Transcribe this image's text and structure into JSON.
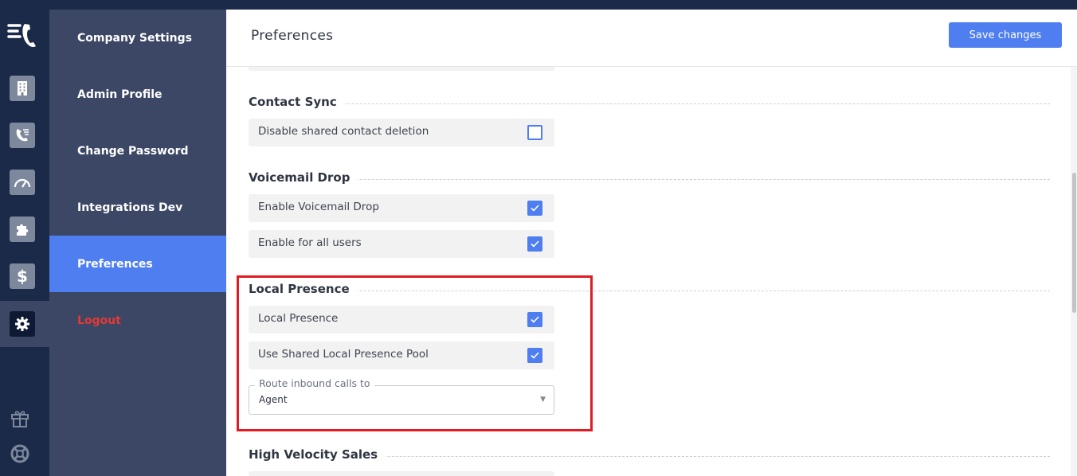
{
  "rail": {
    "icons": [
      "logo-icon",
      "building-icon",
      "phone-list-icon",
      "speedometer-icon",
      "puzzle-icon",
      "dollar-icon",
      "gear-icon",
      "gift-icon",
      "lifebuoy-icon"
    ]
  },
  "nav": {
    "items": [
      {
        "label": "Company Settings"
      },
      {
        "label": "Admin Profile"
      },
      {
        "label": "Change Password"
      },
      {
        "label": "Integrations Dev"
      },
      {
        "label": "Preferences"
      },
      {
        "label": "Logout"
      }
    ],
    "active": "Preferences"
  },
  "header": {
    "title": "Preferences",
    "save_label": "Save changes"
  },
  "sections": {
    "contact_sync": {
      "title": "Contact Sync",
      "rows": [
        {
          "label": "Disable shared contact deletion",
          "checked": false
        }
      ]
    },
    "voicemail_drop": {
      "title": "Voicemail Drop",
      "rows": [
        {
          "label": "Enable Voicemail Drop",
          "checked": true
        },
        {
          "label": "Enable for all users",
          "checked": true
        }
      ]
    },
    "local_presence": {
      "title": "Local Presence",
      "rows": [
        {
          "label": "Local Presence",
          "checked": true
        },
        {
          "label": "Use Shared Local Presence Pool",
          "checked": true
        }
      ],
      "route": {
        "label": "Route inbound calls to",
        "value": "Agent"
      }
    },
    "high_velocity": {
      "title": "High Velocity Sales"
    }
  },
  "colors": {
    "accent": "#4f7ef0",
    "highlight": "#e01b24",
    "rail": "#1c2a4a",
    "nav": "#3b4764",
    "logout": "#e53935"
  }
}
